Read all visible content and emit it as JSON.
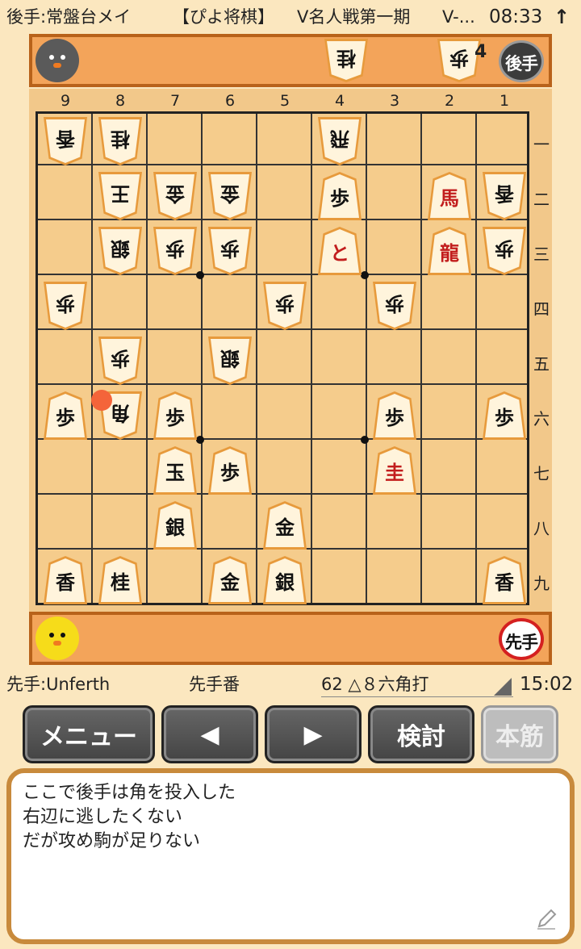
{
  "status_bar": {
    "gote_label": "後手:常盤台メイ",
    "title": "【ぴよ将棋】",
    "event": "V名人戦第一期",
    "event_more": "V-...",
    "time": "08:33",
    "up_arrow": "↑"
  },
  "gote_hand": {
    "pieces": [
      "桂",
      "歩"
    ],
    "pawn_count": "4",
    "badge": "後手"
  },
  "sente_hand": {
    "badge": "先手"
  },
  "board": {
    "files": [
      "9",
      "8",
      "7",
      "6",
      "5",
      "4",
      "3",
      "2",
      "1"
    ],
    "ranks": [
      "一",
      "二",
      "三",
      "四",
      "五",
      "六",
      "七",
      "八",
      "九"
    ],
    "pieces": [
      {
        "file": 9,
        "rank": 1,
        "label": "香",
        "owner": "gote",
        "promoted": false
      },
      {
        "file": 8,
        "rank": 1,
        "label": "桂",
        "owner": "gote",
        "promoted": false
      },
      {
        "file": 4,
        "rank": 1,
        "label": "飛",
        "owner": "gote",
        "promoted": false
      },
      {
        "file": 8,
        "rank": 2,
        "label": "王",
        "owner": "gote",
        "promoted": false
      },
      {
        "file": 7,
        "rank": 2,
        "label": "金",
        "owner": "gote",
        "promoted": false
      },
      {
        "file": 6,
        "rank": 2,
        "label": "金",
        "owner": "gote",
        "promoted": false
      },
      {
        "file": 4,
        "rank": 2,
        "label": "歩",
        "owner": "sente",
        "promoted": false
      },
      {
        "file": 2,
        "rank": 2,
        "label": "馬",
        "owner": "sente",
        "promoted": true
      },
      {
        "file": 1,
        "rank": 2,
        "label": "香",
        "owner": "gote",
        "promoted": false
      },
      {
        "file": 8,
        "rank": 3,
        "label": "銀",
        "owner": "gote",
        "promoted": false
      },
      {
        "file": 7,
        "rank": 3,
        "label": "歩",
        "owner": "gote",
        "promoted": false
      },
      {
        "file": 6,
        "rank": 3,
        "label": "歩",
        "owner": "gote",
        "promoted": false
      },
      {
        "file": 4,
        "rank": 3,
        "label": "と",
        "owner": "sente",
        "promoted": true
      },
      {
        "file": 2,
        "rank": 3,
        "label": "龍",
        "owner": "sente",
        "promoted": true
      },
      {
        "file": 1,
        "rank": 3,
        "label": "歩",
        "owner": "gote",
        "promoted": false
      },
      {
        "file": 9,
        "rank": 4,
        "label": "歩",
        "owner": "gote",
        "promoted": false
      },
      {
        "file": 5,
        "rank": 4,
        "label": "歩",
        "owner": "gote",
        "promoted": false
      },
      {
        "file": 3,
        "rank": 4,
        "label": "歩",
        "owner": "gote",
        "promoted": false
      },
      {
        "file": 8,
        "rank": 5,
        "label": "歩",
        "owner": "gote",
        "promoted": false
      },
      {
        "file": 6,
        "rank": 5,
        "label": "銀",
        "owner": "gote",
        "promoted": false
      },
      {
        "file": 9,
        "rank": 6,
        "label": "歩",
        "owner": "sente",
        "promoted": false
      },
      {
        "file": 8,
        "rank": 6,
        "label": "角",
        "owner": "gote",
        "promoted": false
      },
      {
        "file": 7,
        "rank": 6,
        "label": "歩",
        "owner": "sente",
        "promoted": false
      },
      {
        "file": 3,
        "rank": 6,
        "label": "歩",
        "owner": "sente",
        "promoted": false
      },
      {
        "file": 1,
        "rank": 6,
        "label": "歩",
        "owner": "sente",
        "promoted": false
      },
      {
        "file": 7,
        "rank": 7,
        "label": "玉",
        "owner": "sente",
        "promoted": false
      },
      {
        "file": 6,
        "rank": 7,
        "label": "歩",
        "owner": "sente",
        "promoted": false
      },
      {
        "file": 3,
        "rank": 7,
        "label": "圭",
        "owner": "sente",
        "promoted": true
      },
      {
        "file": 7,
        "rank": 8,
        "label": "銀",
        "owner": "sente",
        "promoted": false
      },
      {
        "file": 5,
        "rank": 8,
        "label": "金",
        "owner": "sente",
        "promoted": false
      },
      {
        "file": 9,
        "rank": 9,
        "label": "香",
        "owner": "sente",
        "promoted": false
      },
      {
        "file": 8,
        "rank": 9,
        "label": "桂",
        "owner": "sente",
        "promoted": false
      },
      {
        "file": 6,
        "rank": 9,
        "label": "金",
        "owner": "sente",
        "promoted": false
      },
      {
        "file": 5,
        "rank": 9,
        "label": "銀",
        "owner": "sente",
        "promoted": false
      },
      {
        "file": 1,
        "rank": 9,
        "label": "香",
        "owner": "sente",
        "promoted": false
      }
    ],
    "last_move_square": {
      "file": 8,
      "rank": 6
    }
  },
  "info": {
    "sente_label": "先手:Unferth",
    "turn": "先手番",
    "move": "62 △８六角打",
    "clock": "15:02"
  },
  "buttons": {
    "menu": "メニュー",
    "prev": "◀",
    "next": "▶",
    "analyze": "検討",
    "mainline": "本筋"
  },
  "comment": {
    "lines": [
      "ここで後手は角を投入した",
      "右辺に逃したくない",
      "だが攻め駒が足りない"
    ]
  },
  "colors": {
    "board": "#f5cc8c",
    "hand_area": "#f3a45a",
    "promoted_text": "#c21d1d",
    "button": "#555555"
  }
}
